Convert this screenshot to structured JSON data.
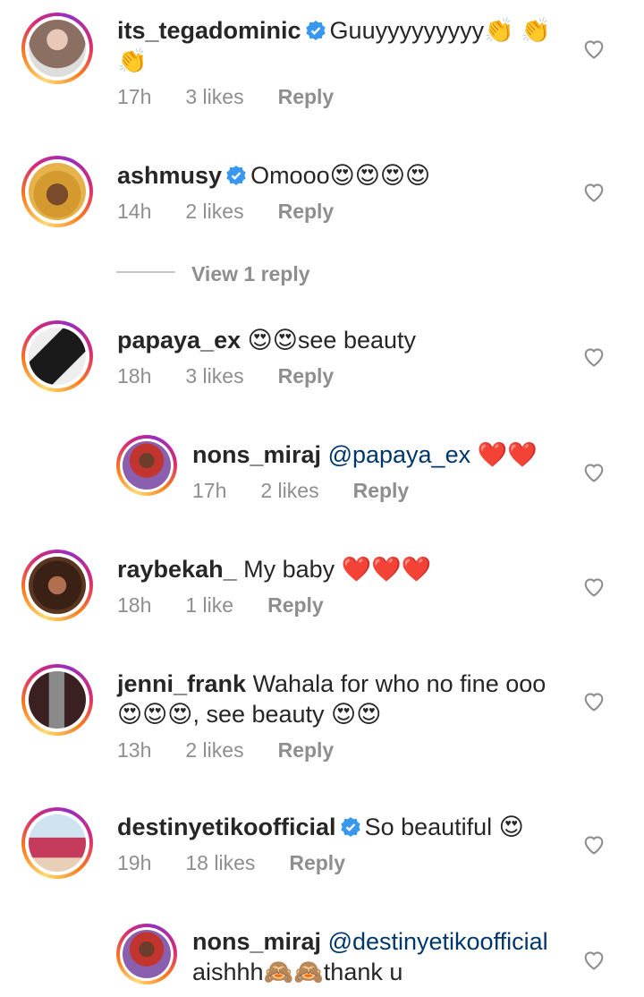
{
  "comments": [
    {
      "username": "its_tegadominic",
      "verified": true,
      "text": "Guuyyyyyyyyy👏 👏 👏",
      "time": "17h",
      "likes": "3 likes",
      "reply": "Reply",
      "avatar_color": "#8a6f62"
    },
    {
      "username": "ashmusy",
      "verified": true,
      "text": "Omooo😍😍😍😍",
      "time": "14h",
      "likes": "2 likes",
      "reply": "Reply",
      "avatar_color": "#b5762a"
    },
    {
      "username": "papaya_ex",
      "verified": false,
      "text": "😍😍see beauty",
      "time": "18h",
      "likes": "3 likes",
      "reply": "Reply",
      "avatar_color": "#2b2b2b"
    },
    {
      "username": "nons_miraj",
      "verified": false,
      "mention": "@papaya_ex",
      "text": " ❤️❤️",
      "time": "17h",
      "likes": "2 likes",
      "reply": "Reply",
      "avatar_color": "#c2352e"
    },
    {
      "username": "raybekah_",
      "verified": false,
      "text": "My baby ❤️❤️❤️",
      "time": "18h",
      "likes": "1 like",
      "reply": "Reply",
      "avatar_color": "#6b3f2a"
    },
    {
      "username": "jenni_frank",
      "verified": false,
      "text": "Wahala for who no fine ooo 😍😍😍, see beauty 😍😍",
      "time": "13h",
      "likes": "2 likes",
      "reply": "Reply",
      "avatar_color": "#4a2a2a"
    },
    {
      "username": "destinyetikoofficial",
      "verified": true,
      "text": "So beautiful 😍",
      "time": "19h",
      "likes": "18 likes",
      "reply": "Reply",
      "avatar_color": "#c53b5c"
    },
    {
      "username": "nons_miraj",
      "verified": false,
      "mention": "@destinyetikoofficial",
      "text": "aishhh🙈🙈thank u",
      "time": "",
      "likes": "",
      "reply": "",
      "avatar_color": "#c2352e"
    }
  ],
  "view_replies": "View 1 reply",
  "colors": {
    "verified": "#3897f0",
    "meta": "#8e8e8e",
    "mention": "#00376b"
  }
}
